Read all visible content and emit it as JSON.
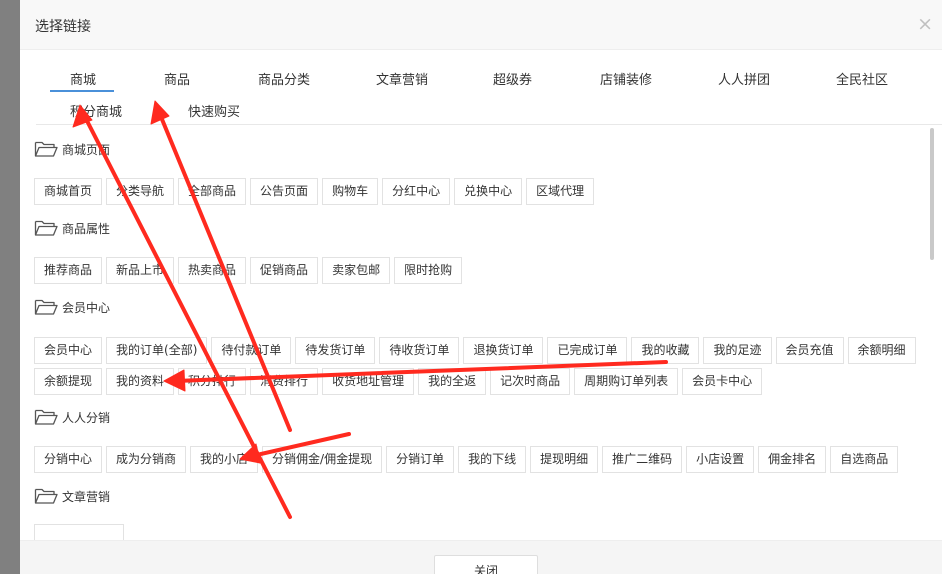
{
  "dialog": {
    "title": "选择链接",
    "close_symbol": "×",
    "footer_button": "关闭"
  },
  "tabs": [
    "商城",
    "商品",
    "商品分类",
    "文章营销",
    "超级券",
    "店铺装修",
    "人人拼团",
    "全民社区",
    "积分商城",
    "快速购买"
  ],
  "active_tab": "商城",
  "accent_color": "#4a90d9",
  "annotation_color": "#ff2a1f",
  "sections": [
    {
      "title": "商城页面",
      "rows": [
        [
          "商城首页",
          "分类导航",
          "全部商品",
          "公告页面",
          "购物车",
          "分红中心",
          "兑换中心",
          "区域代理"
        ]
      ]
    },
    {
      "title": "商品属性",
      "rows": [
        [
          "推荐商品",
          "新品上市",
          "热卖商品",
          "促销商品",
          "卖家包邮",
          "限时抢购"
        ]
      ]
    },
    {
      "title": "会员中心",
      "rows": [
        [
          "会员中心",
          "我的订单(全部)",
          "待付款订单",
          "待发货订单",
          "待收货订单",
          "退换货订单",
          "已完成订单",
          "我的收藏",
          "我的足迹",
          "会员充值",
          "余额明细"
        ],
        [
          "余额提现",
          "我的资料",
          "积分排行",
          "消费排行",
          "收货地址管理",
          "我的全返",
          "记次时商品",
          "周期购订单列表",
          "会员卡中心"
        ]
      ]
    },
    {
      "title": "人人分销",
      "rows": [
        [
          "分销中心",
          "成为分销商",
          "我的小店",
          "分销佣金/佣金提现",
          "分销订单",
          "我的下线",
          "提现明细",
          "推广二维码",
          "小店设置",
          "佣金排名",
          "自选商品"
        ]
      ]
    },
    {
      "title": "文章营销",
      "rows": []
    }
  ]
}
